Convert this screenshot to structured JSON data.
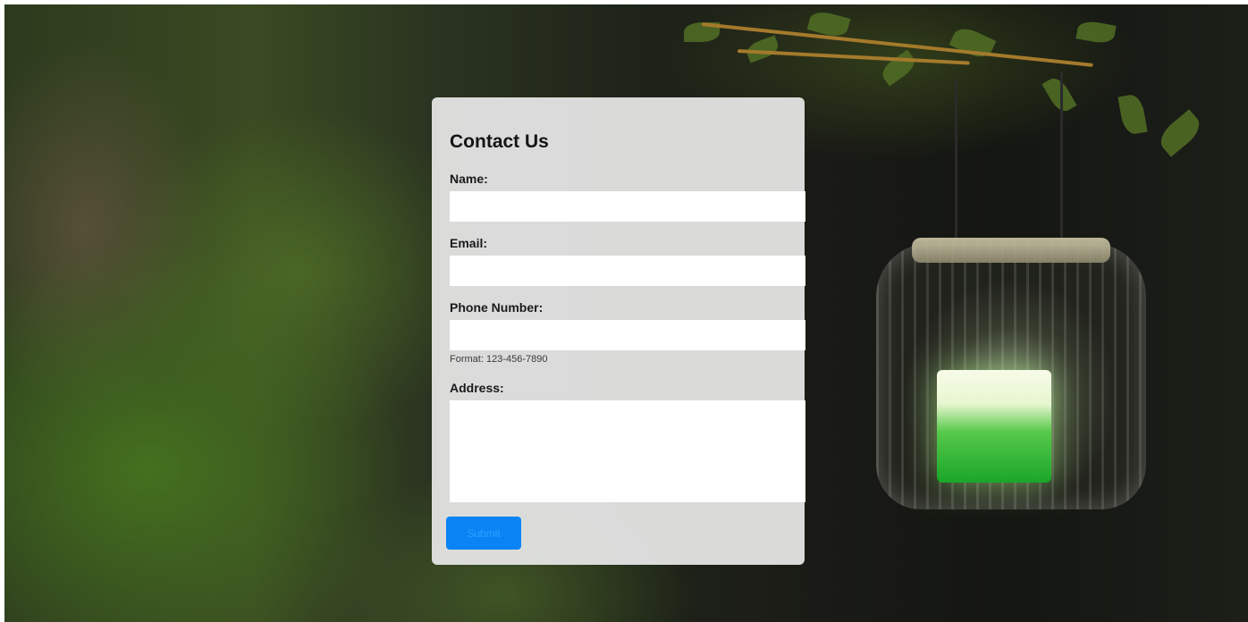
{
  "form": {
    "title": "Contact Us",
    "name_label": "Name:",
    "name_value": "",
    "email_label": "Email:",
    "email_value": "",
    "phone_label": "Phone Number:",
    "phone_value": "",
    "phone_hint": "Format: 123-456-7890",
    "address_label": "Address:",
    "address_value": "",
    "submit_label": "Submit"
  },
  "colors": {
    "card_background": "#e8e8e8",
    "submit_button": "#0a84f5",
    "submit_text": "#2aa0ff",
    "input_background": "#ffffff"
  }
}
